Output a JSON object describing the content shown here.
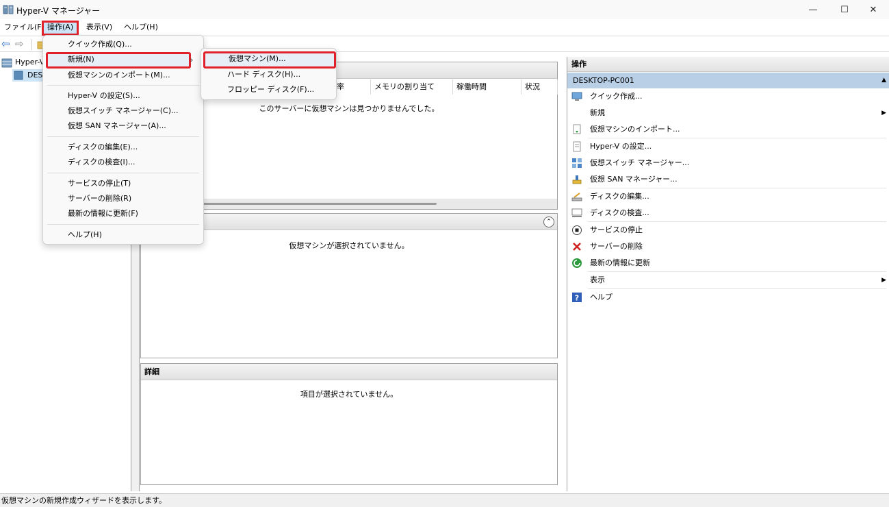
{
  "window": {
    "title": "Hyper-V マネージャー",
    "minimize_glyph": "—",
    "maximize_glyph": "☐",
    "close_glyph": "✕"
  },
  "menubar": {
    "file": "ファイル(F)",
    "action": "操作(A)",
    "view": "表示(V)",
    "help": "ヘルプ(H)"
  },
  "toolbar": {
    "back_glyph": "⇦",
    "forward_glyph": "⇨"
  },
  "tree": {
    "root": "Hyper-V",
    "host": "DES"
  },
  "vm_panel": {
    "columns": [
      "用率",
      "メモリの割り当て",
      "稼働時間",
      "状況"
    ],
    "empty_message": "このサーバーに仮想マシンは見つかりませんでした。"
  },
  "checkpoint_panel": {
    "collapse_glyph": "⌃",
    "empty_message": "仮想マシンが選択されていません。"
  },
  "details_panel": {
    "title": "詳細",
    "empty_message": "項目が選択されていません。"
  },
  "actions_pane": {
    "title": "操作",
    "host": "DESKTOP-PC001",
    "collapse_glyph": "▲",
    "items": [
      {
        "label": "クイック作成..."
      },
      {
        "label": "新規",
        "arrow": "▶"
      },
      {
        "label": "仮想マシンのインポート..."
      },
      {
        "label": "Hyper-V の設定..."
      },
      {
        "label": "仮想スイッチ マネージャー..."
      },
      {
        "label": "仮想 SAN マネージャー..."
      },
      {
        "label": "ディスクの編集..."
      },
      {
        "label": "ディスクの検査..."
      },
      {
        "label": "サービスの停止"
      },
      {
        "label": "サーバーの削除"
      },
      {
        "label": "最新の情報に更新"
      },
      {
        "label": "表示",
        "arrow": "▶"
      },
      {
        "label": "ヘルプ"
      }
    ]
  },
  "action_menu": {
    "items": [
      "クイック作成(Q)...",
      "新規(N)",
      "仮想マシンのインポート(M)...",
      "Hyper-V の設定(S)...",
      "仮想スイッチ マネージャー(C)...",
      "仮想 SAN マネージャー(A)...",
      "ディスクの編集(E)...",
      "ディスクの検査(I)...",
      "サービスの停止(T)",
      "サーバーの削除(R)",
      "最新の情報に更新(F)",
      "ヘルプ(H)"
    ],
    "submenu_arrow": "›"
  },
  "new_submenu": {
    "items": [
      "仮想マシン(M)...",
      "ハード ディスク(H)...",
      "フロッピー ディスク(F)..."
    ]
  },
  "status": {
    "text": "仮想マシンの新規作成ウィザードを表示します。"
  },
  "colors": {
    "highlight_red": "#e0202a",
    "selection_blue": "#b9cfe6"
  }
}
